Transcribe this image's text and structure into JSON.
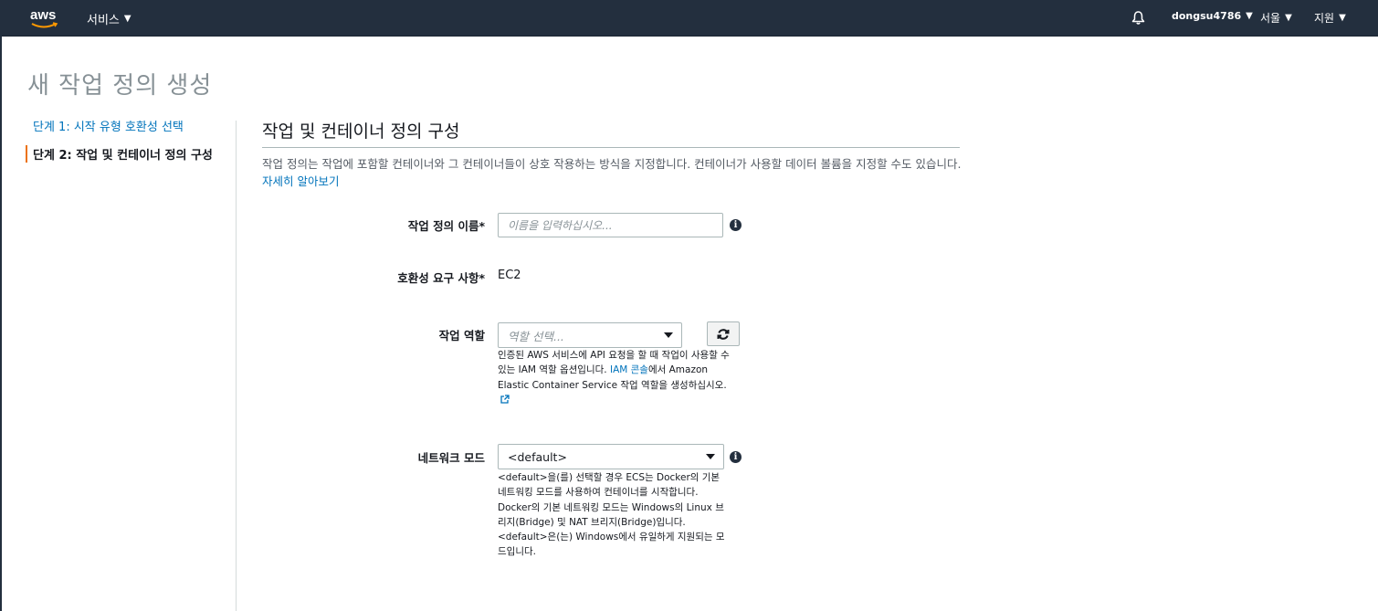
{
  "nav": {
    "logo_text": "aws",
    "services_label": "서비스",
    "user_label": "dongsu4786",
    "region_label": "서울",
    "support_label": "지원"
  },
  "page": {
    "title": "새 작업 정의 생성"
  },
  "steps": [
    {
      "label": "단계 1: 시작 유형 호환성 선택",
      "state": "completed"
    },
    {
      "label": "단계 2: 작업 및 컨테이너 정의 구성",
      "state": "current"
    }
  ],
  "section": {
    "title": "작업 및 컨테이너 정의 구성",
    "description": "작업 정의는 작업에 포함할 컨테이너와 그 컨테이너들이 상호 작용하는 방식을 지정합니다. 컨테이너가 사용할 데이터 볼륨을 지정할 수도 있습니다.",
    "learn_more": "자세히 알아보기"
  },
  "form": {
    "task_name": {
      "label": "작업 정의 이름*",
      "placeholder": "이름을 입력하십시오...",
      "value": ""
    },
    "compatibility": {
      "label": "호환성 요구 사항*",
      "value": "EC2"
    },
    "task_role": {
      "label": "작업 역할",
      "placeholder": "역할 선택...",
      "help_part1": "인증된 AWS 서비스에 API 요청을 할 때 작업이 사용할 수 있는 IAM 역할 옵션입니다. ",
      "help_link": "IAM 콘솔",
      "help_part2": "에서 Amazon Elastic Container Service 작업 역할을 생성하십시오."
    },
    "network_mode": {
      "label": "네트워크 모드",
      "value": "<default>",
      "help": "<default>을(를) 선택할 경우 ECS는 Docker의 기본 네트워킹 모드를 사용하여 컨테이너를 시작합니다. Docker의 기본 네트워킹 모드는 Windows의 Linux 브리지(Bridge) 및 NAT 브리지(Bridge)입니다. <default>은(는) Windows에서 유일하게 지원되는 모드입니다."
    }
  },
  "colors": {
    "nav_bg": "#232f3e",
    "link": "#0073bb",
    "step_accent": "#ec7211"
  },
  "icons": [
    "bell-icon",
    "info-icon",
    "refresh-icon",
    "external-link-icon",
    "caret-down-icon"
  ]
}
